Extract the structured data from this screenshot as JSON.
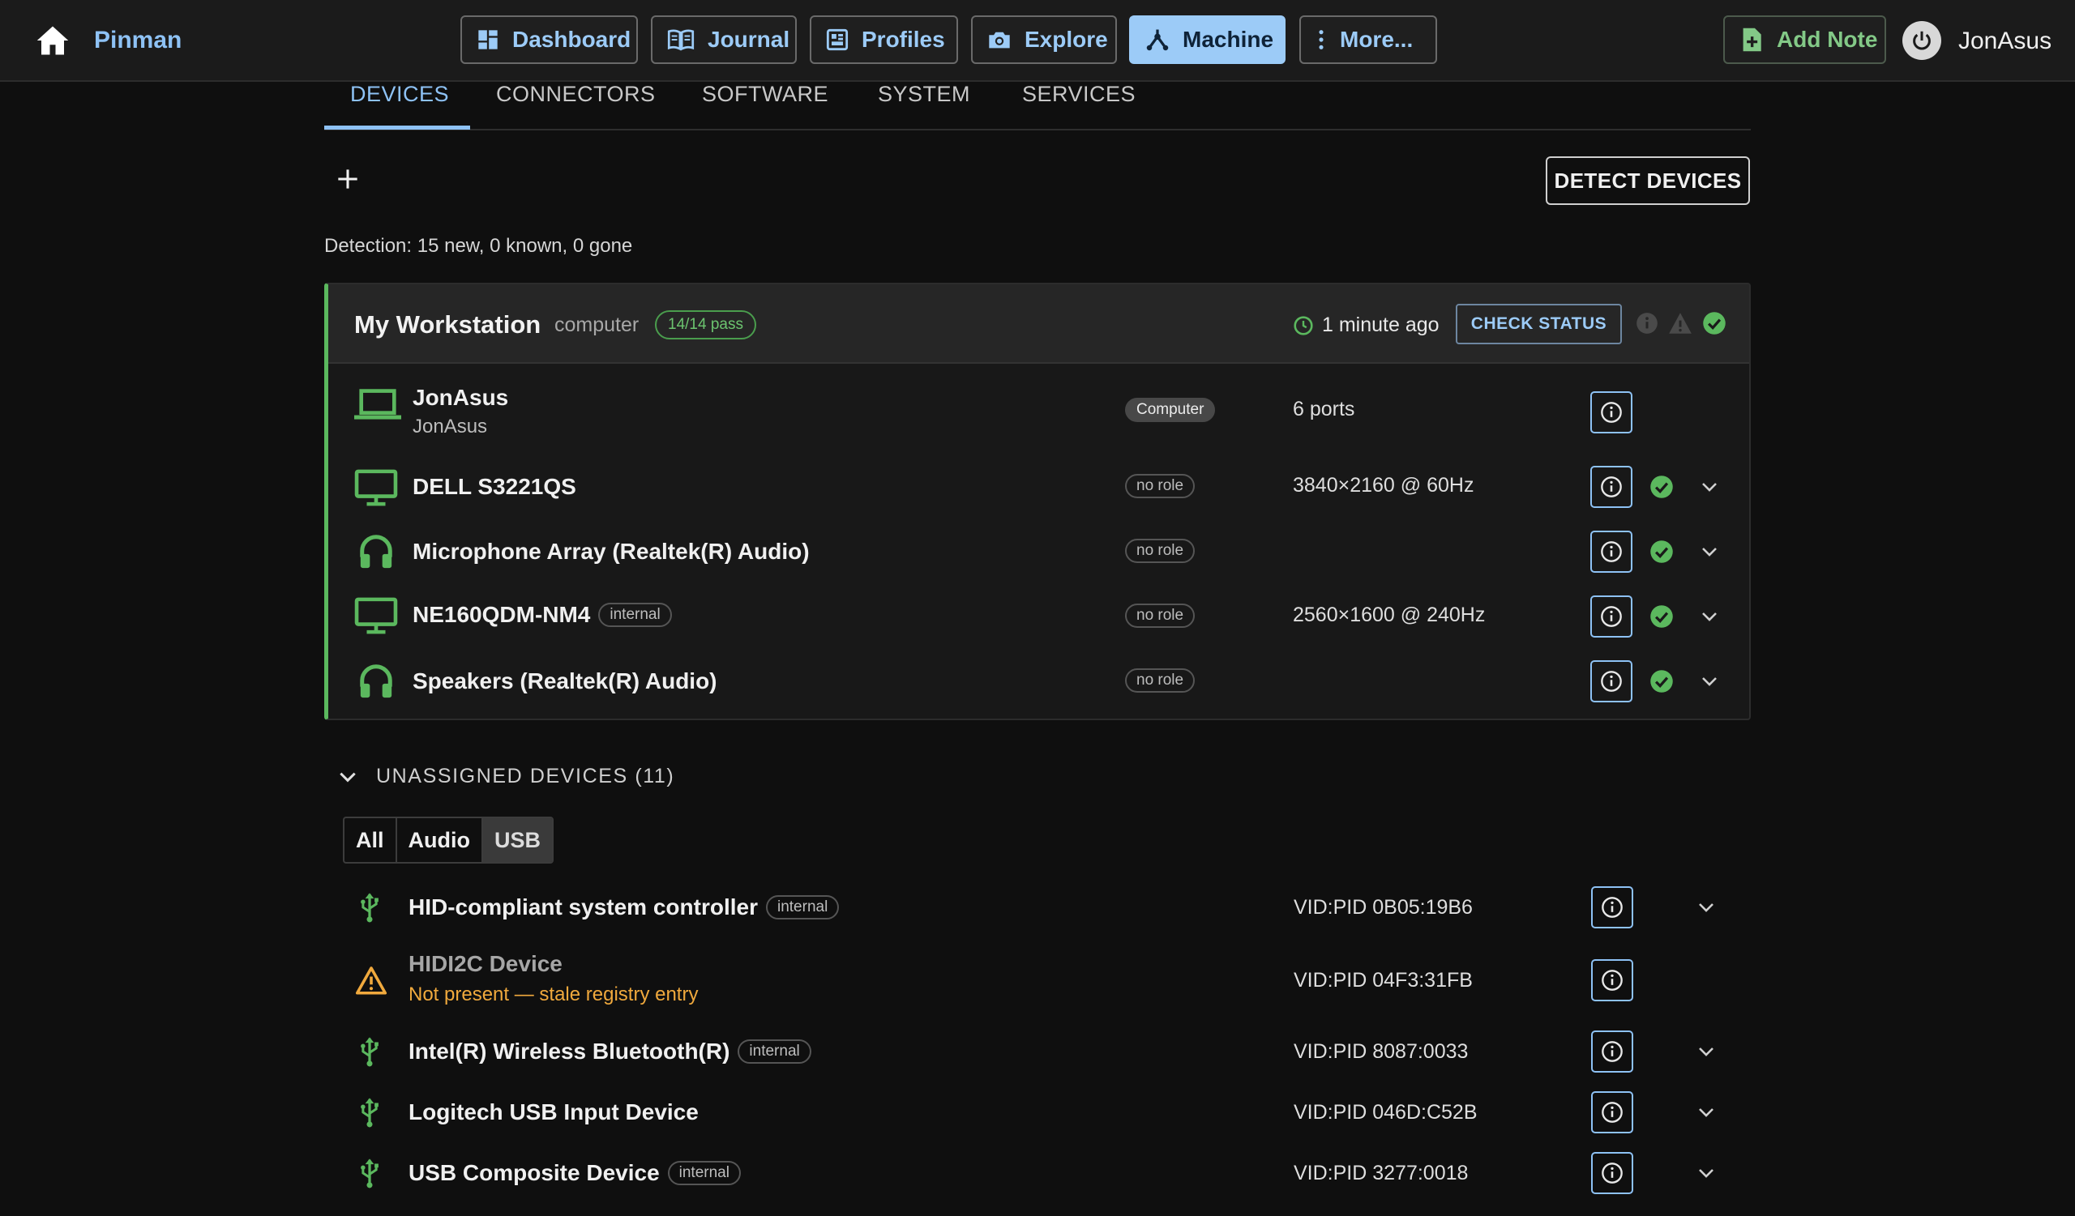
{
  "app": {
    "brand": "Pinman",
    "user": "JonAsus"
  },
  "nav": [
    {
      "label": "Dashboard",
      "icon": "dashboard-icon"
    },
    {
      "label": "Journal",
      "icon": "book-open-icon"
    },
    {
      "label": "Profiles",
      "icon": "profiles-grid-icon"
    },
    {
      "label": "Explore",
      "icon": "camera-icon"
    },
    {
      "label": "Machine",
      "icon": "network-icon",
      "active": true
    },
    {
      "label": "More...",
      "icon": "dots-vertical-icon"
    }
  ],
  "actions": {
    "add_note": "Add Note"
  },
  "tabs": [
    {
      "label": "DEVICES",
      "active": true
    },
    {
      "label": "CONNECTORS"
    },
    {
      "label": "SOFTWARE"
    },
    {
      "label": "SYSTEM"
    },
    {
      "label": "SERVICES"
    }
  ],
  "toolbar": {
    "detect_label": "DETECT DEVICES"
  },
  "detection_summary": "Detection: 15 new, 0 known, 0 gone",
  "workstation": {
    "title": "My Workstation",
    "type": "computer",
    "pass_badge": "14/14 pass",
    "last_check": "1 minute ago",
    "check_status_label": "CHECK STATUS",
    "devices": [
      {
        "name": "JonAsus",
        "sub": "JonAsus",
        "role": "Computer",
        "detail": "6 ports",
        "icon": "laptop-icon"
      },
      {
        "name": "DELL S3221QS",
        "role": "no role",
        "detail": "3840×2160 @ 60Hz",
        "icon": "monitor-icon"
      },
      {
        "name": "Microphone Array (Realtek(R) Audio)",
        "role": "no role",
        "detail": "",
        "icon": "headphones-icon"
      },
      {
        "name": "NE160QDM-NM4",
        "tag": "internal",
        "role": "no role",
        "detail": "2560×1600 @ 240Hz",
        "icon": "monitor-icon"
      },
      {
        "name": "Speakers (Realtek(R) Audio)",
        "role": "no role",
        "detail": "",
        "icon": "headphones-icon"
      }
    ]
  },
  "unassigned": {
    "label": "UNASSIGNED DEVICES (11)",
    "filters": [
      {
        "label": "All"
      },
      {
        "label": "Audio"
      },
      {
        "label": "USB",
        "selected": true
      }
    ],
    "devices": [
      {
        "name": "HID-compliant system controller",
        "tag": "internal",
        "vid": "VID:PID 0B05:19B6",
        "icon": "usb-icon"
      },
      {
        "name": "HIDI2C Device",
        "warning": "Not present — stale registry entry",
        "vid": "VID:PID 04F3:31FB",
        "icon": "warning-icon"
      },
      {
        "name": "Intel(R) Wireless Bluetooth(R)",
        "tag": "internal",
        "vid": "VID:PID 8087:0033",
        "icon": "usb-icon"
      },
      {
        "name": "Logitech USB Input Device",
        "vid": "VID:PID 046D:C52B",
        "icon": "usb-icon"
      },
      {
        "name": "USB Composite Device",
        "tag": "internal",
        "vid": "VID:PID 3277:0018",
        "icon": "usb-icon"
      }
    ]
  },
  "colors": {
    "accent": "#8ec2f5",
    "success": "#5bb85e",
    "warning": "#f0a93d",
    "background": "#0f0f0f"
  }
}
